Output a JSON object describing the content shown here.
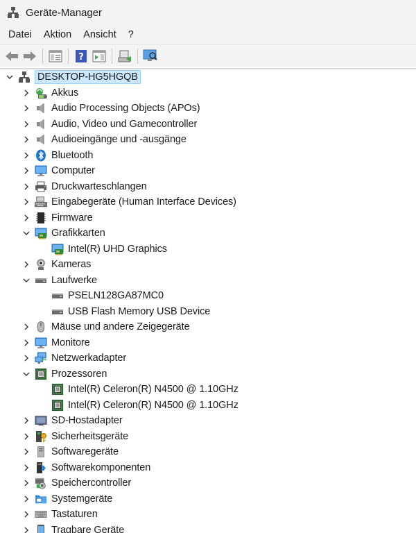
{
  "window": {
    "title": "Geräte-Manager"
  },
  "menu": {
    "items": [
      "Datei",
      "Aktion",
      "Ansicht",
      "?"
    ]
  },
  "toolbar": {
    "buttons": [
      "back-arrow-icon",
      "forward-arrow-icon",
      "properties-icon",
      "help-icon",
      "action-panel-icon",
      "update-driver-icon",
      "scan-hardware-icon"
    ]
  },
  "tree": {
    "root": {
      "label": "DESKTOP-HG5HGQB",
      "expanded": true,
      "selected": true
    },
    "nodes": [
      {
        "label": "Akkus",
        "icon": "battery-icon",
        "level": 1,
        "expanded": false
      },
      {
        "label": "Audio Processing Objects (APOs)",
        "icon": "speaker-icon",
        "level": 1,
        "expanded": false
      },
      {
        "label": "Audio, Video und Gamecontroller",
        "icon": "speaker-icon",
        "level": 1,
        "expanded": false
      },
      {
        "label": "Audioeingänge und -ausgänge",
        "icon": "speaker-icon",
        "level": 1,
        "expanded": false
      },
      {
        "label": "Bluetooth",
        "icon": "bluetooth-icon",
        "level": 1,
        "expanded": false
      },
      {
        "label": "Computer",
        "icon": "monitor-icon",
        "level": 1,
        "expanded": false
      },
      {
        "label": "Druckwarteschlangen",
        "icon": "printer-icon",
        "level": 1,
        "expanded": false
      },
      {
        "label": "Eingabegeräte (Human Interface Devices)",
        "icon": "hid-icon",
        "level": 1,
        "expanded": false
      },
      {
        "label": "Firmware",
        "icon": "chip-icon",
        "level": 1,
        "expanded": false
      },
      {
        "label": "Grafikkarten",
        "icon": "display-adapter-icon",
        "level": 1,
        "expanded": true
      },
      {
        "label": "Intel(R) UHD Graphics",
        "icon": "display-adapter-icon",
        "level": 2
      },
      {
        "label": "Kameras",
        "icon": "webcam-icon",
        "level": 1,
        "expanded": false
      },
      {
        "label": "Laufwerke",
        "icon": "drive-icon",
        "level": 1,
        "expanded": true
      },
      {
        "label": "PSELN128GA87MC0",
        "icon": "drive-icon",
        "level": 2
      },
      {
        "label": "USB Flash Memory USB Device",
        "icon": "drive-icon",
        "level": 2
      },
      {
        "label": "Mäuse und andere Zeigegeräte",
        "icon": "mouse-icon",
        "level": 1,
        "expanded": false
      },
      {
        "label": "Monitore",
        "icon": "monitor-icon",
        "level": 1,
        "expanded": false
      },
      {
        "label": "Netzwerkadapter",
        "icon": "network-icon",
        "level": 1,
        "expanded": false
      },
      {
        "label": "Prozessoren",
        "icon": "processor-icon",
        "level": 1,
        "expanded": true
      },
      {
        "label": "Intel(R) Celeron(R) N4500 @ 1.10GHz",
        "icon": "processor-icon",
        "level": 2
      },
      {
        "label": "Intel(R) Celeron(R) N4500 @ 1.10GHz",
        "icon": "processor-icon",
        "level": 2
      },
      {
        "label": "SD-Hostadapter",
        "icon": "sd-card-icon",
        "level": 1,
        "expanded": false
      },
      {
        "label": "Sicherheitsgeräte",
        "icon": "security-key-icon",
        "level": 1,
        "expanded": false
      },
      {
        "label": "Softwaregeräte",
        "icon": "software-device-icon",
        "level": 1,
        "expanded": false
      },
      {
        "label": "Softwarekomponenten",
        "icon": "puzzle-icon",
        "level": 1,
        "expanded": false
      },
      {
        "label": "Speichercontroller",
        "icon": "storage-controller-icon",
        "level": 1,
        "expanded": false
      },
      {
        "label": "Systemgeräte",
        "icon": "system-folder-icon",
        "level": 1,
        "expanded": false
      },
      {
        "label": "Tastaturen",
        "icon": "keyboard-icon",
        "level": 1,
        "expanded": false
      },
      {
        "label": "Tragbare Geräte",
        "icon": "portable-device-icon",
        "level": 1,
        "expanded": false
      }
    ]
  }
}
